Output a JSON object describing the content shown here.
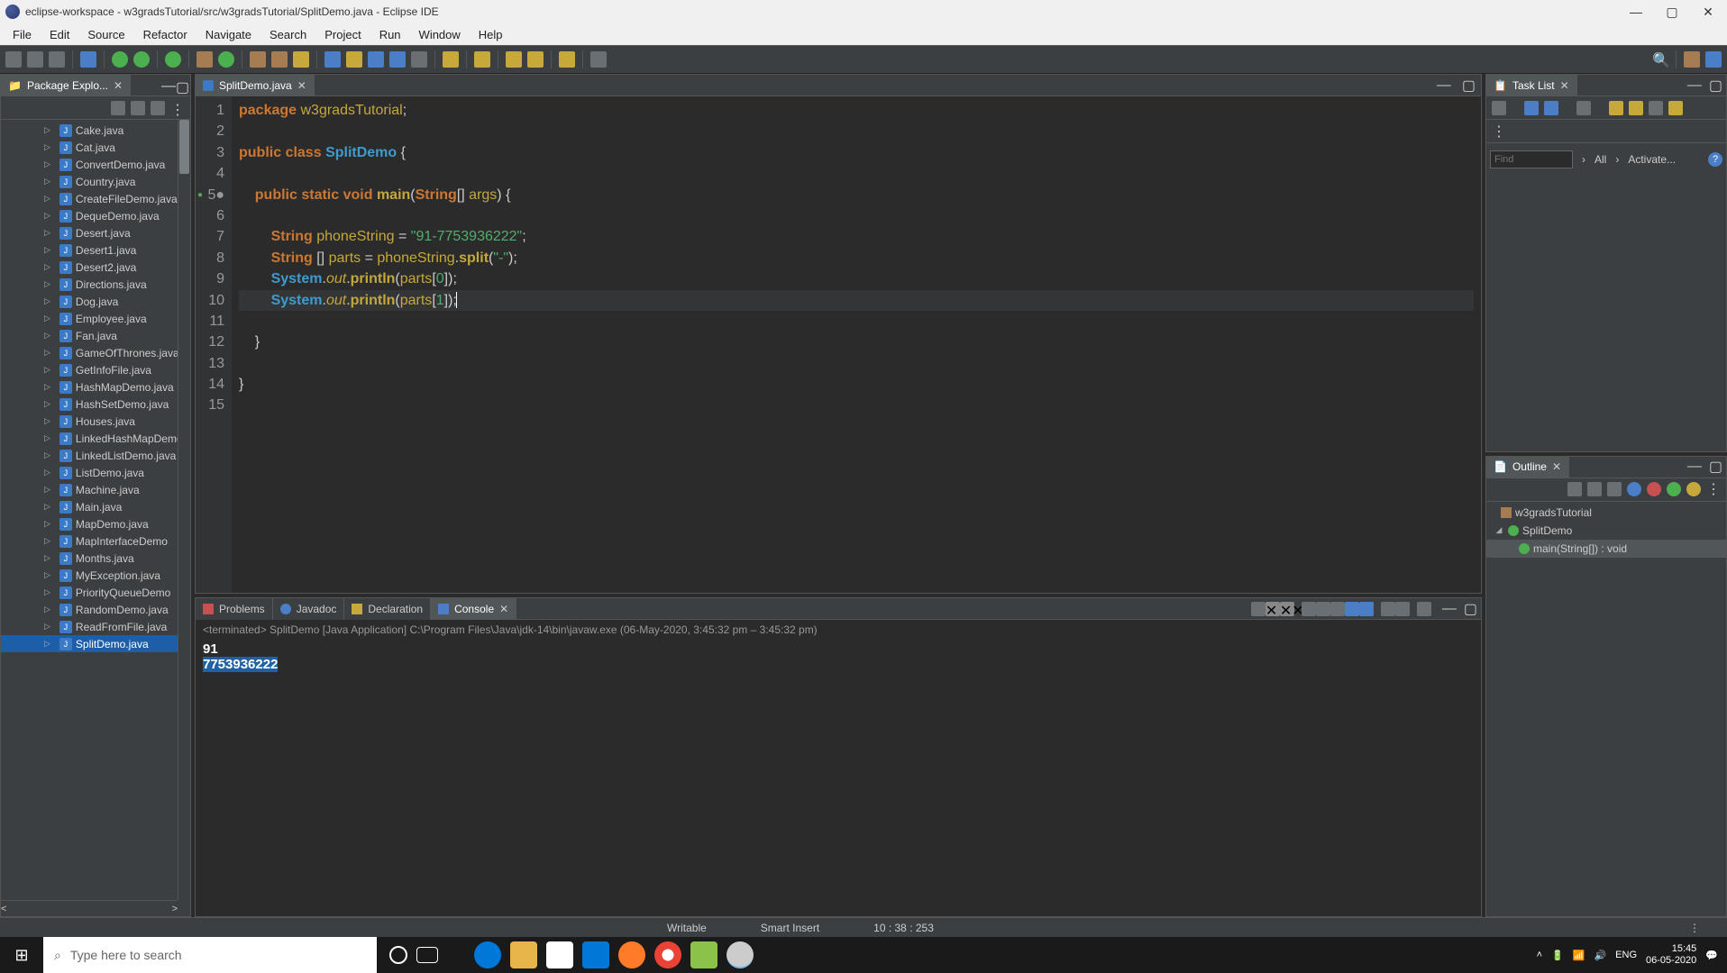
{
  "window": {
    "title": "eclipse-workspace - w3gradsTutorial/src/w3gradsTutorial/SplitDemo.java - Eclipse IDE"
  },
  "menu": [
    "File",
    "Edit",
    "Source",
    "Refactor",
    "Navigate",
    "Search",
    "Project",
    "Run",
    "Window",
    "Help"
  ],
  "explorer": {
    "title": "Package Explo...",
    "files": [
      "Cake.java",
      "Cat.java",
      "ConvertDemo.java",
      "Country.java",
      "CreateFileDemo.java",
      "DequeDemo.java",
      "Desert.java",
      "Desert1.java",
      "Desert2.java",
      "Directions.java",
      "Dog.java",
      "Employee.java",
      "Fan.java",
      "GameOfThrones.java",
      "GetInfoFile.java",
      "HashMapDemo.java",
      "HashSetDemo.java",
      "Houses.java",
      "LinkedHashMapDemo",
      "LinkedListDemo.java",
      "ListDemo.java",
      "Machine.java",
      "Main.java",
      "MapDemo.java",
      "MapInterfaceDemo",
      "Months.java",
      "MyException.java",
      "PriorityQueueDemo",
      "RandomDemo.java",
      "ReadFromFile.java",
      "SplitDemo.java"
    ],
    "selected": "SplitDemo.java"
  },
  "editor": {
    "tab": "SplitDemo.java",
    "lines": 15,
    "code": {
      "package_kw": "package",
      "package_name": "w3gradsTutorial",
      "public": "public",
      "class_kw": "class",
      "class_name": "SplitDemo",
      "static": "static",
      "void": "void",
      "main": "main",
      "string": "String",
      "args": "args",
      "phoneVar": "phoneString",
      "phoneLit": "\"91-7753936222\"",
      "parts": "parts",
      "split": "split",
      "dashLit": "\"-\"",
      "system": "System",
      "out": "out",
      "println": "println",
      "idx0": "0",
      "idx1": "1"
    }
  },
  "console": {
    "tabs": {
      "problems": "Problems",
      "javadoc": "Javadoc",
      "declaration": "Declaration",
      "console": "Console"
    },
    "termline": "<terminated> SplitDemo [Java Application] C:\\Program Files\\Java\\jdk-14\\bin\\javaw.exe  (06-May-2020, 3:45:32 pm – 3:45:32 pm)",
    "out1": "91",
    "out2": "7753936222"
  },
  "task": {
    "title": "Task List",
    "find_placeholder": "Find",
    "all": "All",
    "activate": "Activate..."
  },
  "outline": {
    "title": "Outline",
    "pkg": "w3gradsTutorial",
    "cls": "SplitDemo",
    "method": "main(String[]) : void"
  },
  "status": {
    "writable": "Writable",
    "insert": "Smart Insert",
    "pos": "10 : 38 : 253"
  },
  "taskbar": {
    "search_placeholder": "Type here to search",
    "lang": "ENG",
    "time": "15:45",
    "date": "06-05-2020"
  }
}
